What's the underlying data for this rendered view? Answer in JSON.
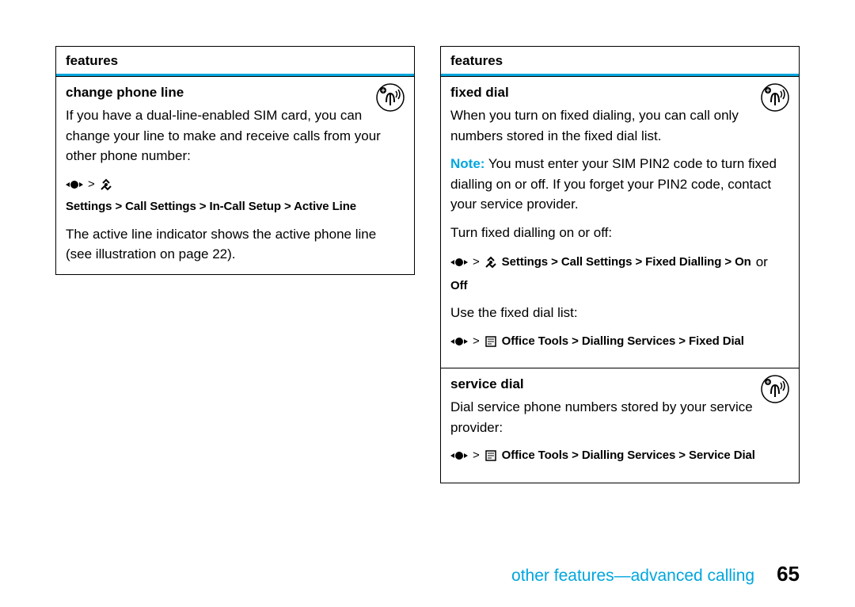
{
  "left": {
    "header": "features",
    "item1": {
      "title": "change phone line",
      "p1": "If you have a dual-line-enabled SIM card, you can change your line to make and receive calls from your other phone number:",
      "nav": " Settings > Call Settings > In-Call Setup > Active Line",
      "p2": "The active line indicator shows the active phone line (see illustration on page 22)."
    }
  },
  "right": {
    "header": "features",
    "item1": {
      "title": "fixed dial",
      "p1": "When you turn on fixed dialing, you can call only numbers stored in the fixed dial list.",
      "noteLabel": "Note:",
      "note": " You must enter your SIM PIN2 code to turn fixed dialling on or off. If you forget your PIN2 code, contact your service provider.",
      "p2": "Turn fixed dialling on or off:",
      "nav1a": " Settings > Call Settings > Fixed Dialling > On",
      "nav1b": " or ",
      "nav1c": "Off",
      "p3": "Use the fixed dial list:",
      "nav2": " Office Tools > Dialling Services > Fixed Dial"
    },
    "item2": {
      "title": "service dial",
      "p1": "Dial service phone numbers stored by your service provider:",
      "nav": " Office Tools > Dialling Services > Service Dial"
    }
  },
  "footer": {
    "title": "other features—advanced calling",
    "page": "65"
  }
}
